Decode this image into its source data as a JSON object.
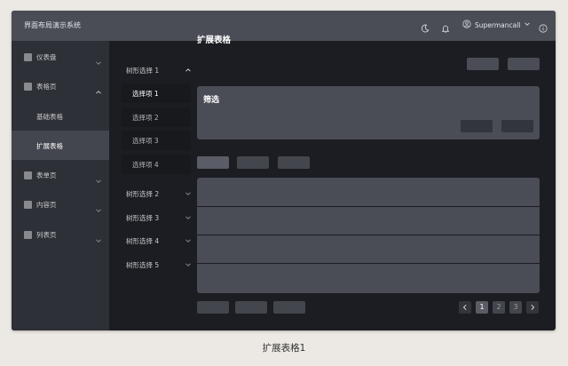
{
  "app": {
    "title": "界面布局演示系统"
  },
  "header": {
    "user_name": "Supermancall",
    "icons": [
      "moon-icon",
      "bell-icon",
      "user-icon",
      "chevron-down-icon",
      "info-icon"
    ]
  },
  "sidebar": {
    "items": [
      {
        "label": "仪表盘",
        "icon": "square-icon",
        "expanded": false
      },
      {
        "label": "表格页",
        "icon": "square-icon",
        "expanded": true
      },
      {
        "label": "表单页",
        "icon": "square-icon",
        "expanded": false
      },
      {
        "label": "内容页",
        "icon": "square-icon",
        "expanded": false
      },
      {
        "label": "列表页",
        "icon": "square-icon",
        "expanded": false
      }
    ],
    "sub_items": [
      {
        "label": "基础表格",
        "active": false
      },
      {
        "label": "扩展表格",
        "active": true
      }
    ]
  },
  "tree": {
    "groups": [
      {
        "label": "树形选择 1",
        "expanded": true
      },
      {
        "label": "树形选择 2",
        "expanded": false
      },
      {
        "label": "树形选择 3",
        "expanded": false
      },
      {
        "label": "树形选择 4",
        "expanded": false
      },
      {
        "label": "树形选择 5",
        "expanded": false
      }
    ],
    "options": [
      {
        "label": "选择项 1",
        "active": true
      },
      {
        "label": "选择项 2",
        "active": false
      },
      {
        "label": "选择项 3",
        "active": false
      },
      {
        "label": "选择项 4",
        "active": false
      }
    ]
  },
  "main": {
    "title": "扩展表格",
    "filter_title": "筛选"
  },
  "pagination": {
    "pages": [
      "1",
      "2",
      "3"
    ],
    "current": "1"
  },
  "caption": "扩展表格1",
  "colors": {
    "topbar": "#4a4c56",
    "sidebar": "#2d3036",
    "content_bg": "#1b1d22",
    "panel": "#4a4c56",
    "active_item": "#43464e"
  }
}
